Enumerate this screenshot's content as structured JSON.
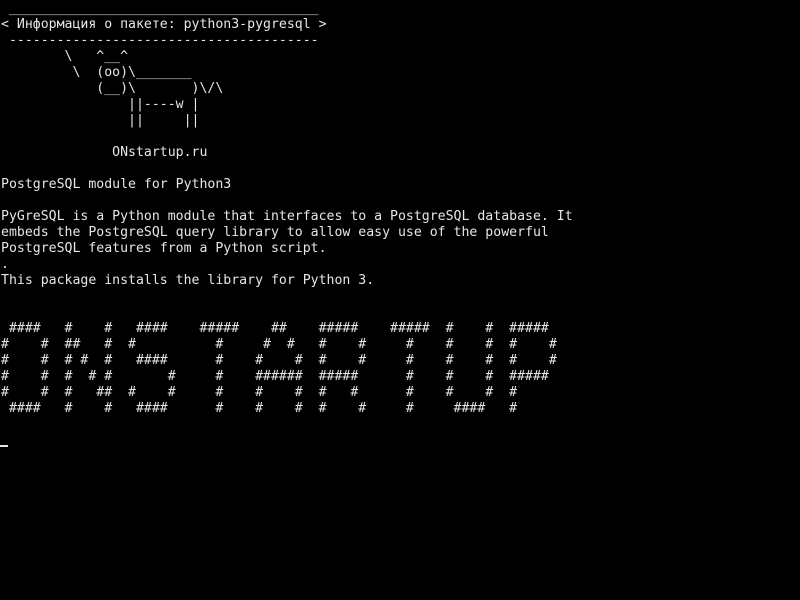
{
  "colors": {
    "background": "#000000",
    "foreground": "#e6e6e6"
  },
  "terminal": {
    "lines": [
      " _______________________________________",
      "< Информация о пакете: python3-pygresql >",
      " ---------------------------------------",
      "        \\   ^__^",
      "         \\  (oo)\\_______",
      "            (__)\\       )\\/\\",
      "                ||----w |",
      "                ||     ||",
      "",
      "              ONstartup.ru",
      "",
      "PostgreSQL module for Python3",
      "",
      "PyGreSQL is a Python module that interfaces to a PostgreSQL database. It",
      "embeds the PostgreSQL query library to allow easy use of the powerful",
      "PostgreSQL features from a Python script.",
      ".",
      "This package installs the library for Python 3.",
      "",
      "",
      " ####   #    #   ####    #####    ##    #####    #####  #    #  #####",
      "#    #  ##   #  #          #     #  #   #    #     #    #    #  #    #",
      "#    #  # #  #   ####      #    #    #  #    #     #    #    #  #    #",
      "#    #  #  # #       #     #    ######  #####      #    #    #  #####",
      "#    #  #   ##  #    #     #    #    #  #   #      #    #    #  #",
      " ####   #    #   ####      #    #    #  #    #     #     ####   #"
    ]
  }
}
